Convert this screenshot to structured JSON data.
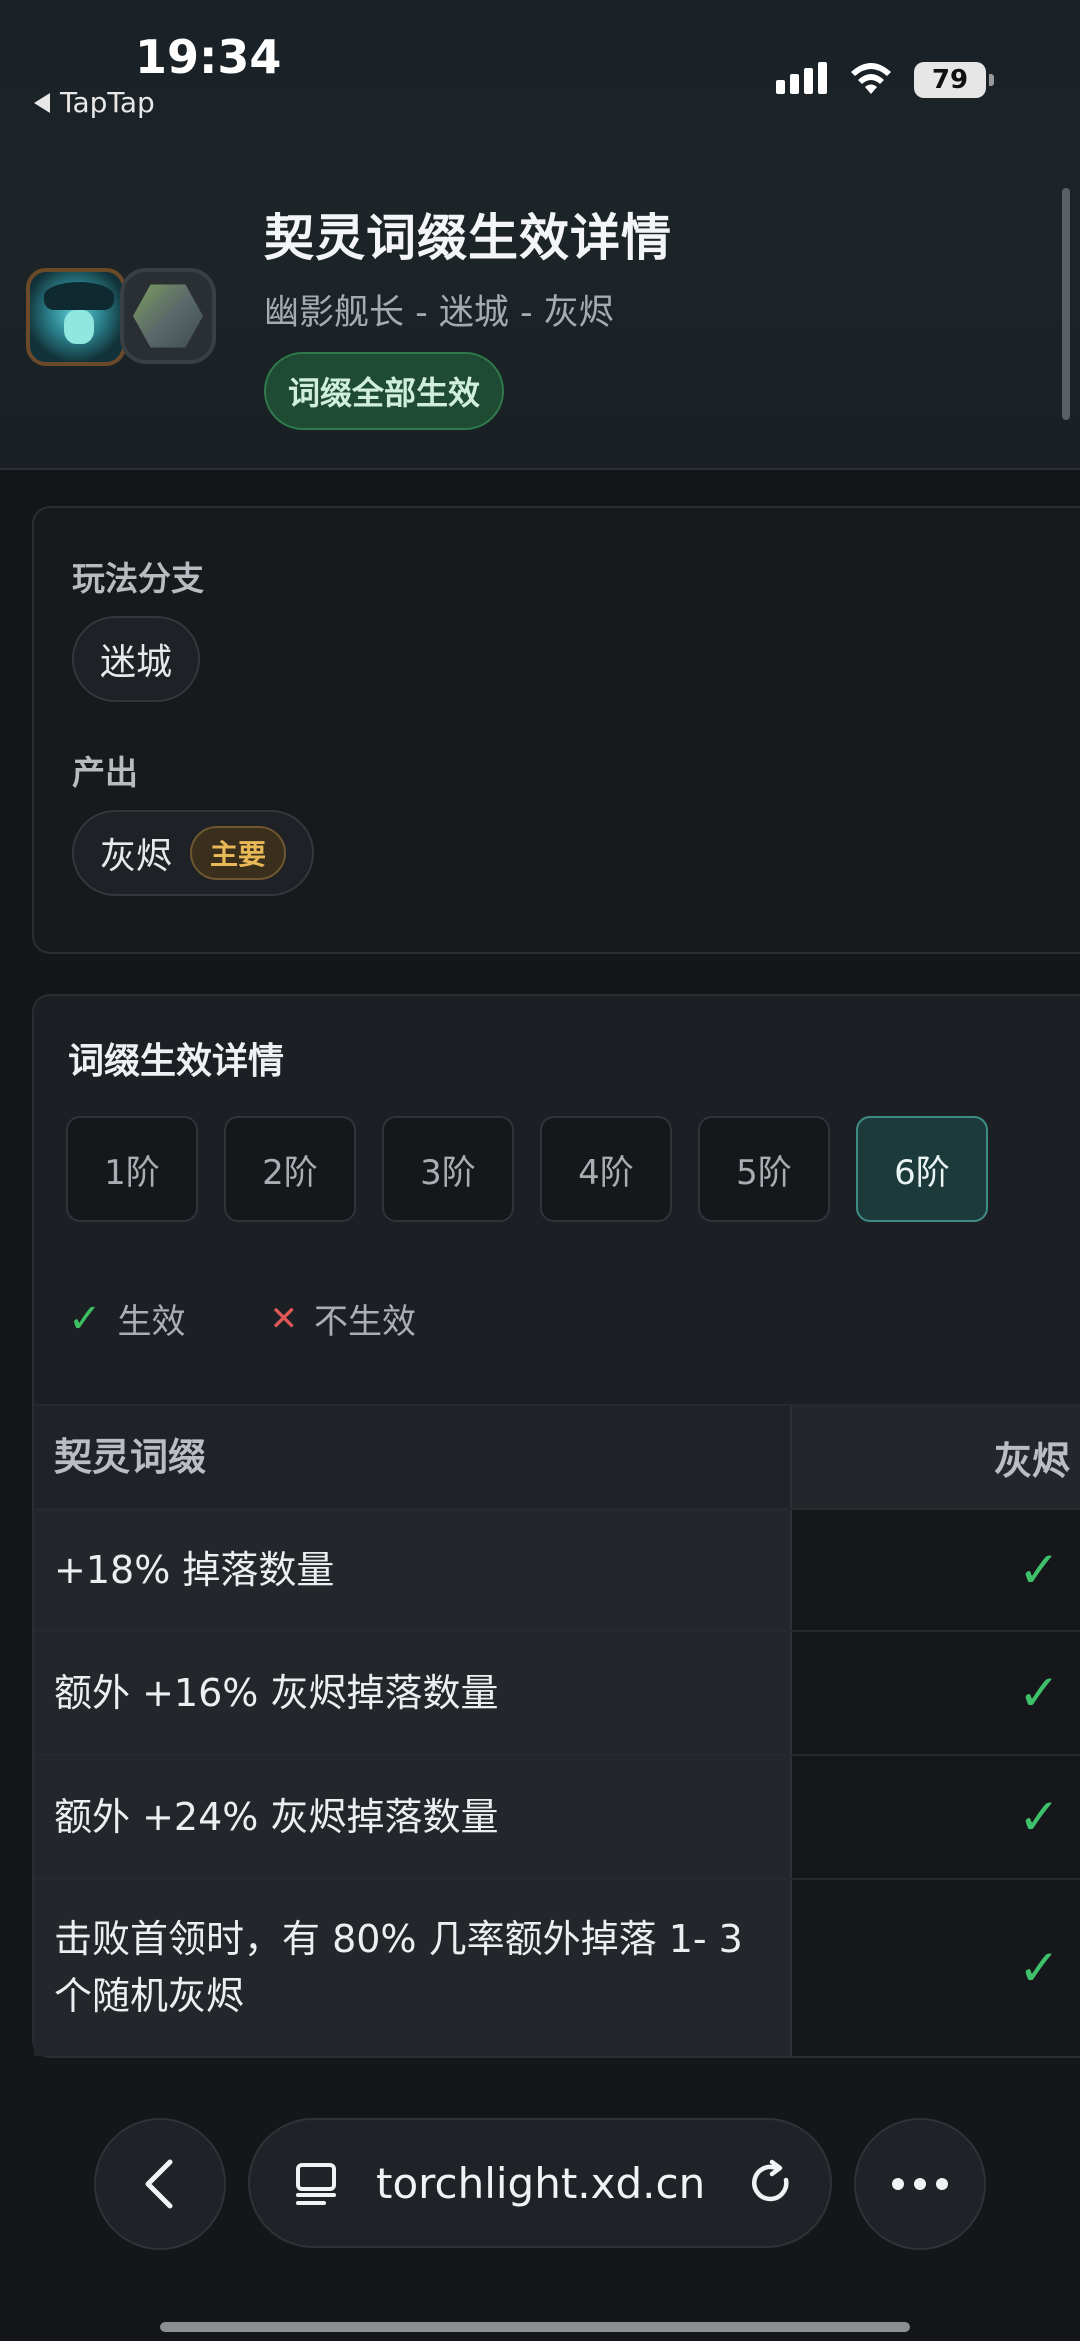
{
  "status_bar": {
    "time": "19:34",
    "back_app": "TapTap",
    "battery": "79"
  },
  "header": {
    "title": "契灵词缀生效详情",
    "subtitle": "幽影舰长 - 迷城 - 灰烬",
    "badge": "词缀全部生效"
  },
  "branch": {
    "label": "玩法分支",
    "value": "迷城"
  },
  "output": {
    "label": "产出",
    "value": "灰烬",
    "tag": "主要"
  },
  "details": {
    "title": "词缀生效详情",
    "tiers": [
      "1阶",
      "2阶",
      "3阶",
      "4阶",
      "5阶",
      "6阶"
    ],
    "active_tier": "6阶",
    "legend_active": "生效",
    "legend_inactive": "不生效",
    "table": {
      "col1": "契灵词缀",
      "col2": "灰烬",
      "rows": [
        {
          "affix": "+18% 掉落数量",
          "effective": true
        },
        {
          "affix": "额外 +16% 灰烬掉落数量",
          "effective": true
        },
        {
          "affix": "额外 +24% 灰烬掉落数量",
          "effective": true
        },
        {
          "affix": "击败首领时，有 80% 几率额外掉落 1- 3个随机灰烬",
          "effective": true
        }
      ]
    }
  },
  "browser": {
    "url": "torchlight.xd.cn"
  },
  "colors": {
    "effective": "#3fc06a",
    "ineffective": "#e05858",
    "main_tag": "#e8b956"
  }
}
